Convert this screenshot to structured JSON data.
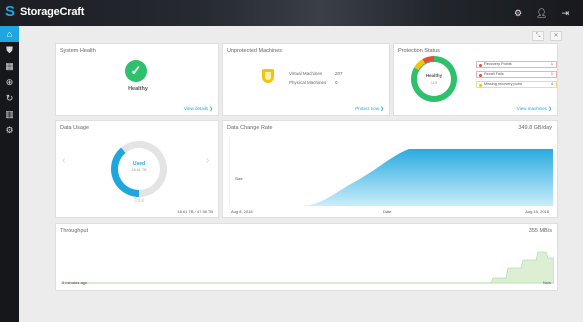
{
  "app": {
    "name": "StorageCraft"
  },
  "header": {
    "icons": [
      "gear-icon",
      "user-icon",
      "logout-icon"
    ]
  },
  "sidebar": {
    "items": [
      "home-icon",
      "shield-icon",
      "map-icon",
      "plus-circle-icon",
      "refresh-icon",
      "bar-chart-icon",
      "settings-gears-icon"
    ]
  },
  "toolbar": {
    "buttons": [
      "expand-icon",
      "close-icon"
    ]
  },
  "system_health": {
    "title": "System Health",
    "status": "Healthy",
    "view_link": "View details ❯"
  },
  "unprotected": {
    "title": "Unprotected Machines",
    "rows": [
      {
        "label": "Virtual Machines",
        "value": "207"
      },
      {
        "label": "Physical Machines",
        "value": "0"
      }
    ],
    "view_link": "Protect now ❯"
  },
  "protection": {
    "title": "Protection Status",
    "donut_label": "Healthy",
    "donut_sub": "115",
    "alerts": [
      {
        "label": "Recovery Points",
        "count": "1",
        "color": "#e74c3c"
      },
      {
        "label": "Recall Fails",
        "count": "1",
        "color": "#e74c3c"
      },
      {
        "label": "Missing recovery point",
        "count": "4",
        "color": "#f1c40f"
      }
    ],
    "view_link": "View machines ❯"
  },
  "data_usage": {
    "title": "Data Usage",
    "center_label": "Used",
    "center_value": "18.61 TB",
    "total_label": "Total",
    "footer": "18.61 TB / 47.38 TB",
    "used_fraction": 0.39
  },
  "change_rate": {
    "title": "Data Change Rate",
    "value": "349.8 GB/day",
    "series_label": "Size",
    "x_start": "Aug 8, 2018",
    "x_mid": "Date",
    "x_end": "Aug 15, 2018"
  },
  "throughput": {
    "title": "Throughput",
    "value": "355 MB/s",
    "x_start": "5 minutes ago",
    "x_end": "Now"
  },
  "colors": {
    "accent": "#1fa6de",
    "healthy": "#2fc06c",
    "warning": "#f1c40f",
    "error": "#e74c3c"
  }
}
